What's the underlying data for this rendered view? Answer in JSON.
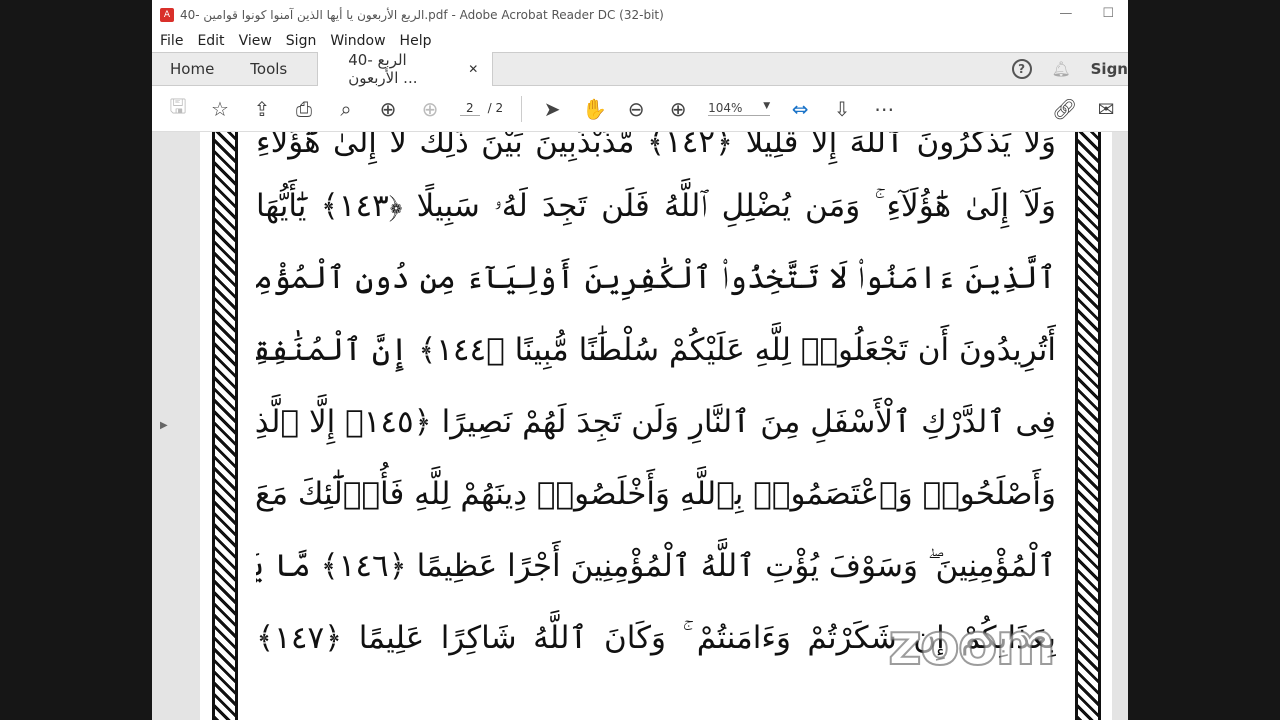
{
  "window": {
    "title": "40- الربع  الأربعون يا أيها الذين آمنوا كونوا قوامين.pdf - Adobe Acrobat Reader DC (32-bit)"
  },
  "menu": [
    "File",
    "Edit",
    "View",
    "Sign",
    "Window",
    "Help"
  ],
  "tabs": {
    "home": "Home",
    "tools": "Tools",
    "doc": "40- الربع  الأربعون ...",
    "sign": "Sign"
  },
  "toolbar": {
    "page_current": "2",
    "page_total": "/ 2",
    "zoom": "104%"
  },
  "document": {
    "lines": [
      "وَلَا يَذْكُرُونَ ٱللَّهَ إِلَّا قَلِيلًا ﴿١٤٢﴾ مُّذَبْذَبِينَ بَيْنَ ذَٰلِكَ لَآ إِلَىٰ هَٰٓؤُلَآءِ",
      "وَلَآ إِلَىٰ هَٰٓؤُلَآءِ ۚ وَمَن يُضْلِلِ ٱللَّهُ فَلَن تَجِدَ لَهُۥ سَبِيلًا ﴿١٤٣﴾ يَٰٓأَيُّهَا",
      "ٱلَّذِينَ ءَامَنُوا۟ لَا تَتَّخِذُوا۟ ٱلْكَٰفِرِينَ أَوْلِيَآءَ مِن دُونِ ٱلْمُؤْمِنِينَ ۚ",
      "أَتُرِيدُونَ أَن تَجْعَلُوا۟ لِلَّهِ عَلَيْكُمْ سُلْطَٰنًا مُّبِينًا ﴿١٤٤﴾ إِنَّ ٱلْمُنَٰفِقِينَ",
      "فِى ٱلدَّرْكِ ٱلْأَسْفَلِ مِنَ ٱلنَّارِ وَلَن تَجِدَ لَهُمْ نَصِيرًا ﴿١٤٥﴾ إِلَّا ٱلَّذِينَ تَابُوا۟",
      "وَأَصْلَحُوا۟ وَٱعْتَصَمُوا۟ بِٱللَّهِ وَأَخْلَصُوا۟ دِينَهُمْ لِلَّهِ فَأُو۟لَٰٓئِكَ مَعَ",
      "ٱلْمُؤْمِنِينَ ۖ وَسَوْفَ يُؤْتِ ٱللَّهُ ٱلْمُؤْمِنِينَ أَجْرًا عَظِيمًا ﴿١٤٦﴾ مَّا يَفْعَلُ ٱللَّهُ",
      "بِعَذَابِكُمْ إِن شَكَرْتُمْ وَءَامَنتُمْ ۚ وَكَانَ ٱللَّهُ شَاكِرًا عَلِيمًا ﴿١٤٧﴾"
    ]
  },
  "watermark": "zoom"
}
